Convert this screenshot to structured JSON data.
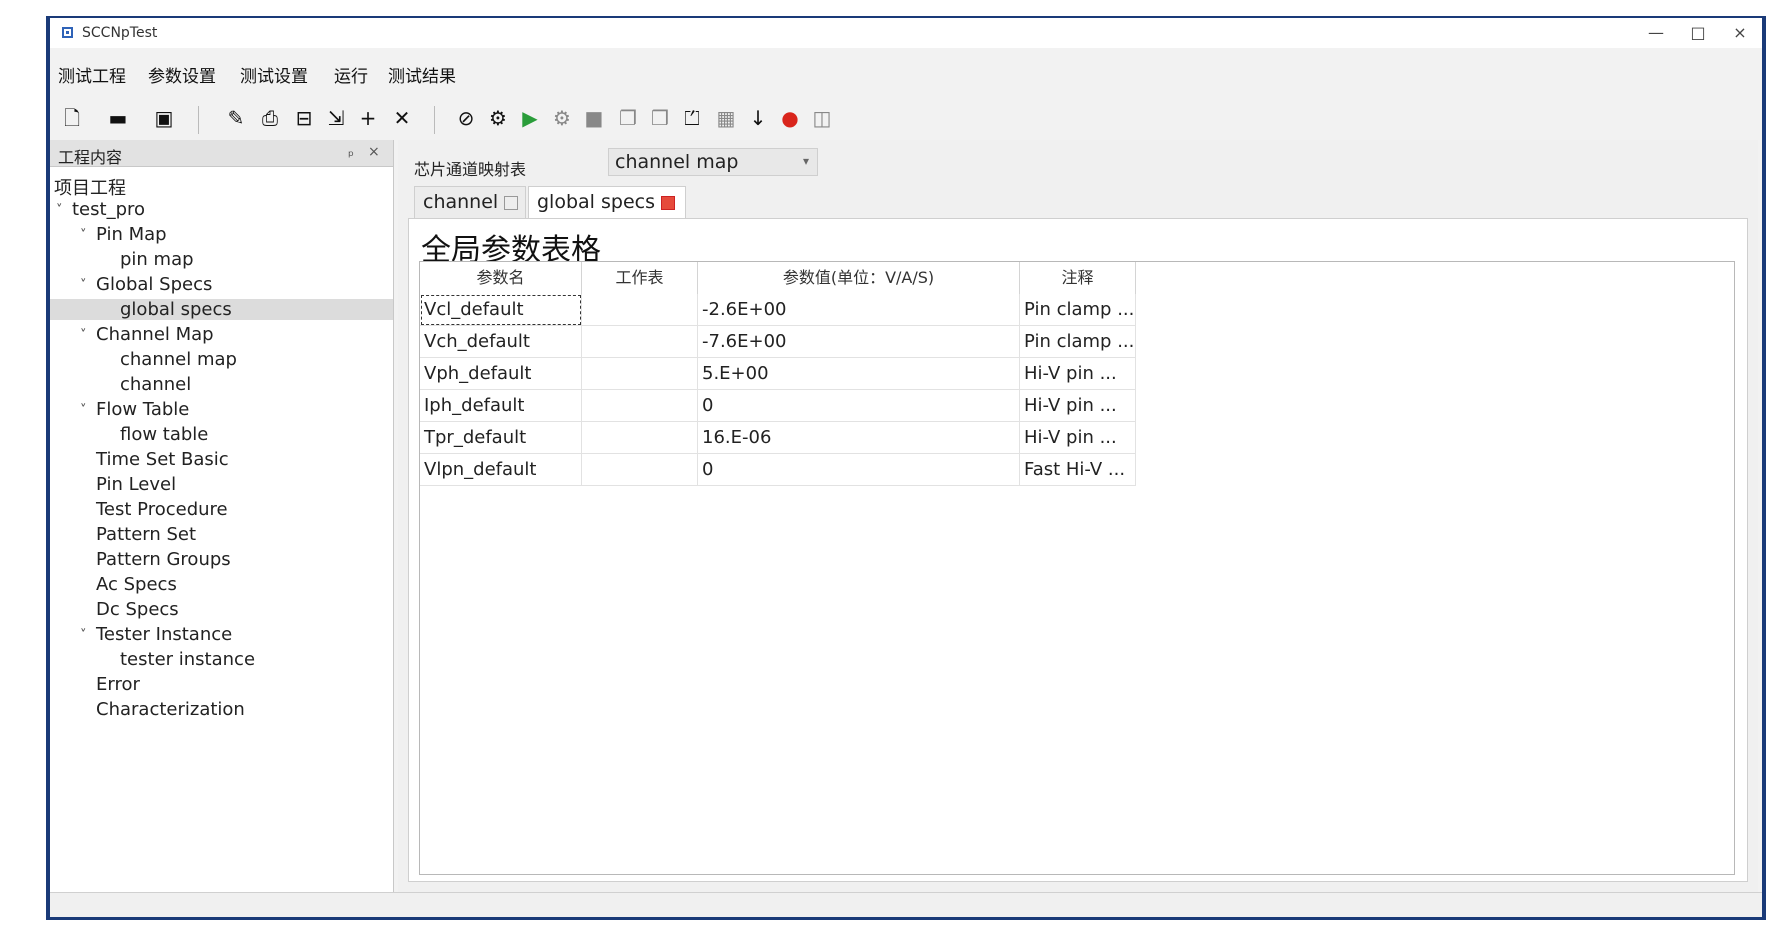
{
  "window": {
    "title": "SCCNpTest",
    "minimize": "—",
    "maximize": "□",
    "close": "×"
  },
  "menu": [
    "测试工程",
    "参数设置",
    "测试设置",
    "运行",
    "测试结果"
  ],
  "toolbar": [
    {
      "icon": "new-project-icon",
      "glyph": "🗋"
    },
    {
      "icon": "open-folder-icon",
      "glyph": "▬"
    },
    {
      "icon": "save-icon",
      "glyph": "▣"
    },
    {
      "icon": "edit-icon",
      "glyph": "✎"
    },
    {
      "icon": "print-icon",
      "glyph": "⎙"
    },
    {
      "icon": "grid-icon",
      "glyph": "⊟"
    },
    {
      "icon": "move-icon",
      "glyph": "⇲"
    },
    {
      "icon": "add-icon",
      "glyph": "+"
    },
    {
      "icon": "delete-icon",
      "glyph": "✕"
    },
    {
      "icon": "stop-icon",
      "glyph": "⊘"
    },
    {
      "icon": "settings-icon",
      "glyph": "⚙"
    },
    {
      "icon": "run-icon",
      "glyph": "▶"
    },
    {
      "icon": "debug-icon",
      "glyph": "⚙"
    },
    {
      "icon": "pause-icon",
      "glyph": "■"
    },
    {
      "icon": "copy-icon",
      "glyph": "❐"
    },
    {
      "icon": "paste-icon",
      "glyph": "❒"
    },
    {
      "icon": "export-icon",
      "glyph": "⏍"
    },
    {
      "icon": "chart-icon",
      "glyph": "▦"
    },
    {
      "icon": "download-icon",
      "glyph": "↓"
    },
    {
      "icon": "record-icon",
      "glyph": "●"
    },
    {
      "icon": "monitor-icon",
      "glyph": "◫"
    }
  ],
  "left_panel": {
    "title": "工程内容",
    "float_btn": "ₚ",
    "close_btn": "×",
    "tree": [
      {
        "label": "项目工程",
        "level": 0,
        "arrow": false
      },
      {
        "label": "test_pro",
        "level": 1,
        "arrow": true
      },
      {
        "label": "Pin Map",
        "level": 2,
        "arrow": true
      },
      {
        "label": "pin map",
        "level": 3,
        "arrow": false
      },
      {
        "label": "Global Specs",
        "level": 2,
        "arrow": true
      },
      {
        "label": "global specs",
        "level": 3,
        "arrow": false,
        "selected": true
      },
      {
        "label": "Channel Map",
        "level": 2,
        "arrow": true
      },
      {
        "label": "channel map",
        "level": 3,
        "arrow": false
      },
      {
        "label": "channel",
        "level": 3,
        "arrow": false
      },
      {
        "label": "Flow Table",
        "level": 2,
        "arrow": true
      },
      {
        "label": "flow table",
        "level": 3,
        "arrow": false
      },
      {
        "label": "Time Set Basic",
        "level": 2,
        "arrow": false
      },
      {
        "label": "Pin Level",
        "level": 2,
        "arrow": false
      },
      {
        "label": "Test Procedure",
        "level": 2,
        "arrow": false
      },
      {
        "label": "Pattern Set",
        "level": 2,
        "arrow": false
      },
      {
        "label": "Pattern Groups",
        "level": 2,
        "arrow": false
      },
      {
        "label": "Ac Specs",
        "level": 2,
        "arrow": false
      },
      {
        "label": "Dc Specs",
        "level": 2,
        "arrow": false
      },
      {
        "label": "Tester Instance",
        "level": 2,
        "arrow": true
      },
      {
        "label": "tester instance",
        "level": 3,
        "arrow": false
      },
      {
        "label": "Error",
        "level": 2,
        "arrow": false
      },
      {
        "label": "Characterization",
        "level": 2,
        "arrow": false
      }
    ]
  },
  "main": {
    "combo_label": "芯片通道映射表",
    "combo_value": "channel map",
    "tabs": [
      {
        "label": "channel",
        "active": false
      },
      {
        "label": "global specs",
        "active": true
      }
    ],
    "heading": "全局参数表格",
    "table": {
      "headers": [
        "参数名",
        "工作表",
        "参数值(单位：V/A/S)",
        "注释"
      ],
      "rows": [
        [
          "Vcl_default",
          "",
          "-2.6E+00",
          "Pin clamp ..."
        ],
        [
          "Vch_default",
          "",
          "-7.6E+00",
          "Pin clamp ..."
        ],
        [
          "Vph_default",
          "",
          "5.E+00",
          "Hi-V pin ..."
        ],
        [
          "Iph_default",
          "",
          "0",
          "Hi-V pin ..."
        ],
        [
          "Tpr_default",
          "",
          "16.E-06",
          "Hi-V pin ..."
        ],
        [
          "Vlpn_default",
          "",
          "0",
          "Fast Hi-V ..."
        ]
      ]
    }
  }
}
